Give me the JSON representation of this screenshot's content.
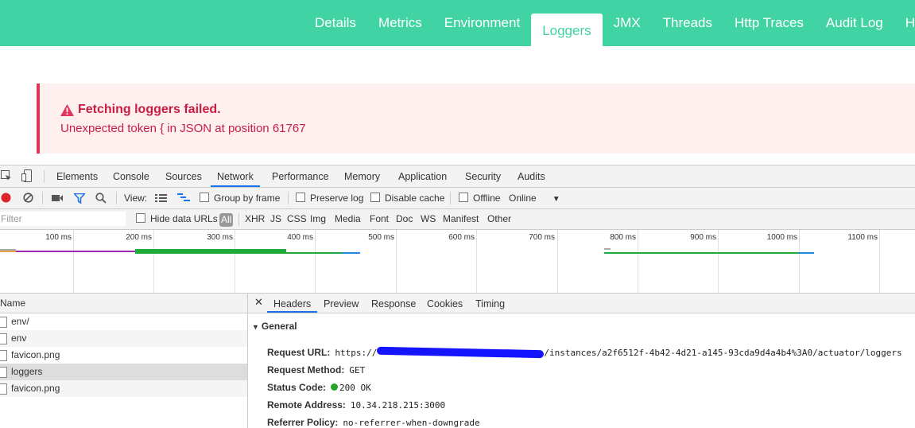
{
  "nav": {
    "tabs": [
      {
        "label": "Details"
      },
      {
        "label": "Metrics"
      },
      {
        "label": "Environment"
      },
      {
        "label": "Loggers",
        "active": true
      },
      {
        "label": "JMX"
      },
      {
        "label": "Threads"
      },
      {
        "label": "Http Traces"
      },
      {
        "label": "Audit Log"
      },
      {
        "label": "Heap D"
      }
    ]
  },
  "error": {
    "title": "Fetching loggers failed.",
    "message": "Unexpected token { in JSON at position 61767",
    "icon": "warning-triangle-icon"
  },
  "devtools": {
    "tabs": [
      "Elements",
      "Console",
      "Sources",
      "Network",
      "Performance",
      "Memory",
      "Application",
      "Security",
      "Audits"
    ],
    "active_tab": "Network",
    "toolbar": {
      "view_label": "View:",
      "group_by_frame": "Group by frame",
      "preserve_log": "Preserve log",
      "disable_cache": "Disable cache",
      "offline": "Offline",
      "throttle": "Online"
    },
    "filter": {
      "placeholder": "Filter",
      "hide_data_urls": "Hide data URLs",
      "types": [
        "All",
        "XHR",
        "JS",
        "CSS",
        "Img",
        "Media",
        "Font",
        "Doc",
        "WS",
        "Manifest",
        "Other"
      ],
      "active_type": "All"
    },
    "timeline": {
      "ticks": [
        "100 ms",
        "200 ms",
        "300 ms",
        "400 ms",
        "500 ms",
        "600 ms",
        "700 ms",
        "800 ms",
        "900 ms",
        "1000 ms",
        "1100 ms"
      ]
    },
    "requests": {
      "header": "Name",
      "rows": [
        {
          "name": "env/"
        },
        {
          "name": "env"
        },
        {
          "name": "favicon.png"
        },
        {
          "name": "loggers",
          "selected": true
        },
        {
          "name": "favicon.png"
        }
      ]
    },
    "detail": {
      "tabs": [
        "Headers",
        "Preview",
        "Response",
        "Cookies",
        "Timing"
      ],
      "active_tab": "Headers",
      "section": "General",
      "request_url_label": "Request URL:",
      "request_url_prefix": "https://",
      "request_url_suffix": "/instances/a2f6512f-4b42-4d21-a145-93cda9d4a4b4%3A0/actuator/loggers",
      "request_method_label": "Request Method:",
      "request_method": "GET",
      "status_code_label": "Status Code:",
      "status_code": "200 OK",
      "remote_address_label": "Remote Address:",
      "remote_address": "10.34.218.215:3000",
      "referrer_policy_label": "Referrer Policy:",
      "referrer_policy": "no-referrer-when-downgrade"
    }
  },
  "colors": {
    "nav_bg": "#42d3a5",
    "error_text": "#c81d43",
    "error_bg": "#fff0f0",
    "accent": "#1a73e8"
  }
}
